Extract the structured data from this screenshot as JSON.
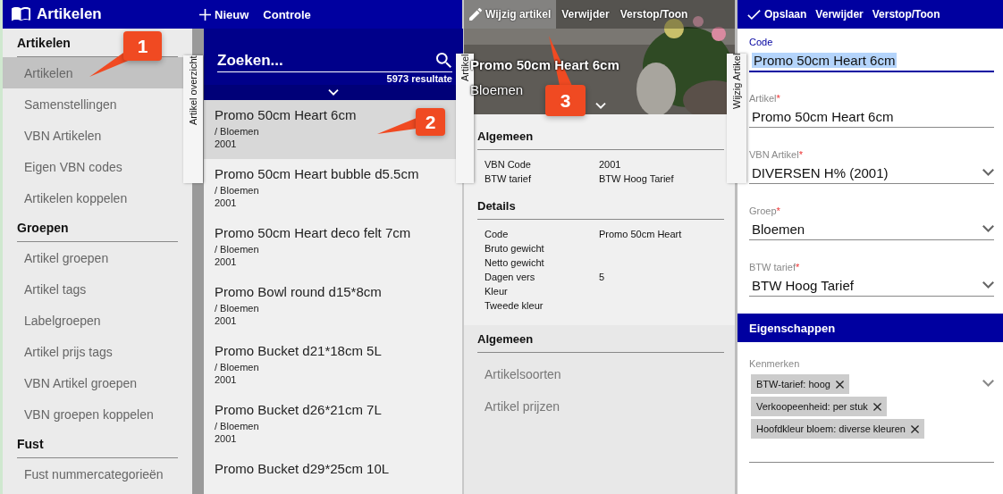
{
  "app_bar": {
    "title": "Artikelen",
    "actions": [
      {
        "label": "Nieuw"
      },
      {
        "label": "Controle"
      }
    ]
  },
  "sidebar": {
    "groups": [
      {
        "title": "Artikelen",
        "items": [
          {
            "label": "Artikelen",
            "selected": true
          },
          {
            "label": "Samenstellingen",
            "selected": false
          },
          {
            "label": "VBN Artikelen",
            "selected": false
          },
          {
            "label": "Eigen VBN codes",
            "selected": false
          },
          {
            "label": "Artikelen koppelen",
            "selected": false
          }
        ]
      },
      {
        "title": "Groepen",
        "items": [
          {
            "label": "Artikel groepen",
            "selected": false
          },
          {
            "label": "Artikel tags",
            "selected": false
          },
          {
            "label": "Labelgroepen",
            "selected": false
          },
          {
            "label": "Artikel prijs tags",
            "selected": false
          },
          {
            "label": "VBN Artikel groepen",
            "selected": false
          },
          {
            "label": "VBN groepen koppelen",
            "selected": false
          }
        ]
      },
      {
        "title": "Fust",
        "items": [
          {
            "label": "Fust nummercategorieën",
            "selected": false
          }
        ]
      }
    ]
  },
  "search": {
    "placeholder": "Zoeken...",
    "result_count": "5973 resultate"
  },
  "articles": [
    {
      "title": "Promo 50cm Heart 6cm",
      "group": "/ Bloemen",
      "code": "2001",
      "selected": true
    },
    {
      "title": "Promo 50cm Heart bubble d5.5cm",
      "group": "/ Bloemen",
      "code": "2001",
      "selected": false
    },
    {
      "title": "Promo 50cm Heart deco felt 7cm",
      "group": "/ Bloemen",
      "code": "2001",
      "selected": false
    },
    {
      "title": "Promo Bowl round d15*8cm",
      "group": "/ Bloemen",
      "code": "2001",
      "selected": false
    },
    {
      "title": "Promo Bucket d21*18cm 5L",
      "group": "/ Bloemen",
      "code": "2001",
      "selected": false
    },
    {
      "title": "Promo Bucket d26*21cm 7L",
      "group": "/ Bloemen",
      "code": "2001",
      "selected": false
    },
    {
      "title": "Promo Bucket d29*25cm 10L",
      "selected": false
    }
  ],
  "side_tabs": [
    "Artikel overzicht",
    "Artikel",
    "Wijzig Artikel"
  ],
  "detail": {
    "toolbar": [
      {
        "label": "Wijzig artikel",
        "selected": true
      },
      {
        "label": "Verwijder",
        "selected": false
      },
      {
        "label": "Verstop/Toon",
        "selected": false
      }
    ],
    "title": "Promo 50cm Heart 6cm",
    "subtitle": "Bloemen",
    "sections": [
      {
        "title": "Algemeen",
        "rows": [
          {
            "label": "VBN Code",
            "value": "2001"
          },
          {
            "label": "BTW tarief",
            "value": "BTW Hoog Tarief"
          }
        ]
      },
      {
        "title": "Details",
        "rows": [
          {
            "label": "Code",
            "value": "Promo 50cm Heart"
          },
          {
            "label": "Bruto gewicht"
          },
          {
            "label": "Netto gewicht"
          },
          {
            "label": "Dagen vers",
            "value": "5"
          },
          {
            "label": "Kleur"
          },
          {
            "label": "Tweede kleur"
          }
        ]
      }
    ],
    "links": {
      "title": "Algemeen",
      "items": [
        "Artikelsoorten",
        "Artikel prijzen"
      ]
    }
  },
  "editor": {
    "toolbar": [
      {
        "label": "Opslaan"
      },
      {
        "label": "Verwijder"
      },
      {
        "label": "Verstop/Toon"
      }
    ],
    "fields": [
      {
        "kind": "text",
        "label": "Code",
        "value": "Promo 50cm Heart 6cm",
        "focused": true
      },
      {
        "kind": "text",
        "label": "Artikel",
        "required_mark": "*",
        "value": "Promo 50cm Heart 6cm",
        "focused": false
      },
      {
        "kind": "select",
        "label": "VBN Artikel",
        "required_mark": "*",
        "value": "DIVERSEN H% (2001)",
        "focused": false
      },
      {
        "kind": "select",
        "label": "Groep",
        "required_mark": "*",
        "value": "Bloemen",
        "focused": false
      },
      {
        "kind": "select",
        "label": "BTW tarief",
        "required_mark": "*",
        "value": "BTW Hoog Tarief",
        "focused": false
      }
    ],
    "section": "Eigenschappen",
    "tags_field": {
      "label": "Kenmerken",
      "tags": [
        "BTW-tarief: hoog",
        "Verkoopeenheid: per stuk",
        "Hoofdkleur bloem: diverse kleuren"
      ]
    }
  },
  "callouts": [
    "1",
    "2",
    "3"
  ]
}
